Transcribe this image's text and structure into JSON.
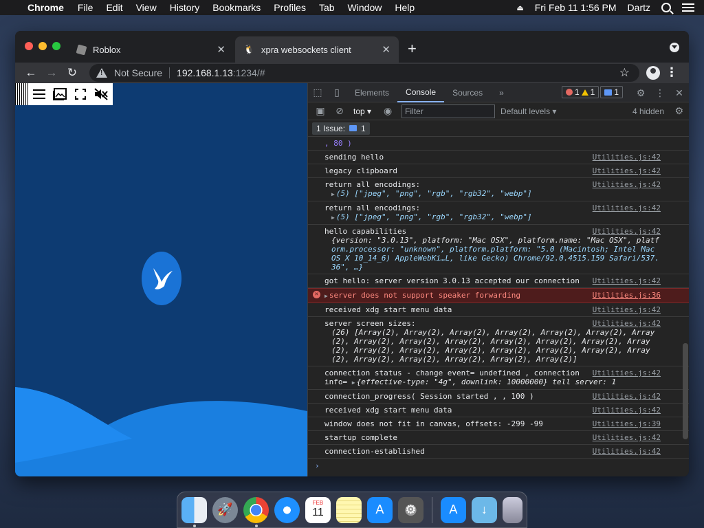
{
  "menubar": {
    "app": "Chrome",
    "items": [
      "File",
      "Edit",
      "View",
      "History",
      "Bookmarks",
      "Profiles",
      "Tab",
      "Window",
      "Help"
    ],
    "clock": "Fri Feb 11  1:56 PM",
    "user": "Dartz"
  },
  "browser": {
    "tabs": [
      {
        "title": "Roblox",
        "active": false
      },
      {
        "title": "xpra websockets client",
        "active": true
      }
    ],
    "security_label": "Not Secure",
    "url_host": "192.168.1.13",
    "url_rest": ":1234/#"
  },
  "devtools": {
    "tabs": [
      "Elements",
      "Console",
      "Sources"
    ],
    "error_count": "1",
    "warning_count": "1",
    "message_count": "1",
    "context": "top",
    "filter_placeholder": "Filter",
    "levels": "Default levels",
    "hidden": "4 hidden",
    "issues_label": "1 Issue:",
    "issues_count": "1"
  },
  "console": {
    "row0": ",  80 )",
    "row1": {
      "text": "sending hello",
      "src": "Utilities.js:42"
    },
    "row2": {
      "text": "legacy clipboard",
      "src": "Utilities.js:42"
    },
    "row3": {
      "text": "return all encodings:",
      "sub": "(5) [\"jpeg\", \"png\", \"rgb\", \"rgb32\", \"webp\"]",
      "src": "Utilities.js:42"
    },
    "row4": {
      "text": "return all encodings:",
      "sub": "(5) [\"jpeg\", \"png\", \"rgb\", \"rgb32\", \"webp\"]",
      "src": "Utilities.js:42"
    },
    "row5": {
      "text": "hello capabilities",
      "sub1": "{version: \"3.0.13\", platform: \"Mac OSX\", platform.name: \"Mac OSX\", platf",
      "sub2": "orm.processor: \"unknown\", platform.platform: \"5.0 (Macintosh; Intel Mac",
      "sub3": "OS X 10_14_6) AppleWebKi…L, like Gecko) Chrome/92.0.4515.159 Safari/537.",
      "sub4": "36\", …}",
      "src": "Utilities.js:42"
    },
    "row6": {
      "text": "got hello: server version 3.0.13 accepted our connection",
      "src": "Utilities.js:42"
    },
    "row7": {
      "text": "server does not support speaker forwarding",
      "src": "Utilities.js:36"
    },
    "row8": {
      "text": "received xdg start menu data",
      "src": "Utilities.js:42"
    },
    "row9": {
      "text": "server screen sizes:",
      "sub1": "(26) [Array(2), Array(2), Array(2), Array(2), Array(2), Array(2), Array",
      "sub2": "(2), Array(2), Array(2), Array(2), Array(2), Array(2), Array(2), Array",
      "sub3": "(2), Array(2), Array(2), Array(2), Array(2), Array(2), Array(2), Array",
      "sub4": "(2), Array(2), Array(2), Array(2), Array(2), Array(2)]",
      "src": "Utilities.js:42"
    },
    "row10": {
      "text": "connection status - change event= undefined , connection",
      "text2": "info= ",
      "info": "{effective-type: \"4g\", downlink: 10000000} tell server: 1",
      "src": "Utilities.js:42"
    },
    "row11": {
      "text": "connection_progress( Session started ,   ,  100 )",
      "src": "Utilities.js:42"
    },
    "row12": {
      "text": "received xdg start menu data",
      "src": "Utilities.js:42"
    },
    "row13": {
      "text": "window does not fit in canvas, offsets:  -299 -99",
      "src": "Utilities.js:39"
    },
    "row14": {
      "text": "startup complete",
      "src": "Utilities.js:42"
    },
    "row15": {
      "text": "connection-established",
      "src": "Utilities.js:42"
    }
  },
  "dock": {
    "calendar_month": "FEB",
    "calendar_day": "11"
  },
  "colors": {
    "canvas_bg": "#0d3b72",
    "error_bg": "#4e1c1c",
    "accent": "#8ab4f8"
  }
}
